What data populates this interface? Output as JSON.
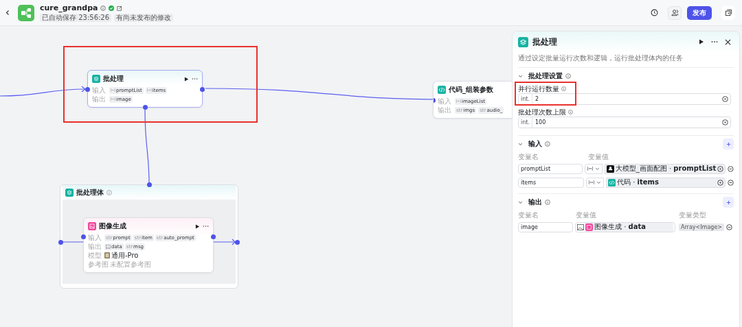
{
  "header": {
    "title": "cure_grandpa",
    "autosave": "已自动保存 23:56:26",
    "unpublished": "有尚未发布的修改",
    "publish": "发布"
  },
  "canvas": {
    "batch_node": {
      "title": "批处理",
      "input_label": "输入",
      "inputs": [
        {
          "kind": "array",
          "label": "promptList"
        },
        {
          "kind": "array",
          "label": "items"
        }
      ],
      "output_label": "输出",
      "outputs": [
        {
          "kind": "array",
          "label": "image"
        }
      ]
    },
    "code_node": {
      "title": "代码_组装参数",
      "input_label": "输入",
      "inputs": [
        {
          "kind": "array",
          "label": "imageList"
        }
      ],
      "output_label": "输出",
      "outputs": [
        {
          "kind": "text",
          "prefix": "str",
          "label": "imgs"
        },
        {
          "kind": "text",
          "prefix": "str",
          "label": "audio_"
        }
      ]
    },
    "batch_body": {
      "title": "批处理体",
      "image_node": {
        "title": "图像生成",
        "input_label": "输入",
        "inputs": [
          {
            "kind": "text",
            "prefix": "str",
            "label": "prompt"
          },
          {
            "kind": "text",
            "prefix": "str",
            "label": "item"
          },
          {
            "kind": "text",
            "prefix": "str",
            "label": "auto_prompt"
          }
        ],
        "output_label": "输出",
        "outputs": [
          {
            "kind": "image",
            "label": "data"
          },
          {
            "kind": "text",
            "prefix": "str",
            "label": "msg"
          }
        ],
        "model_label": "模型",
        "model": "通用-Pro",
        "ref_label": "参考图",
        "ref": "未配置参考图"
      }
    }
  },
  "panel": {
    "title": "批处理",
    "description": "通过设定批量运行次数和逻辑，运行批处理体内的任务",
    "settings": {
      "title": "批处理设置",
      "expanded": true,
      "fields": [
        {
          "label": "并行运行数量",
          "type": "int.",
          "value": "2"
        },
        {
          "label": "批处理次数上限",
          "type": "int.",
          "value": "100"
        }
      ]
    },
    "inputs": {
      "title": "输入",
      "expanded": true,
      "col_name": "变量名",
      "col_value": "变量值",
      "rows": [
        {
          "name": "promptList",
          "kind": "llm",
          "source": "大模型_画面配图 · **promptList**"
        },
        {
          "name": "items",
          "kind": "code",
          "source": "代码 · **items**"
        }
      ]
    },
    "outputs": {
      "title": "输出",
      "expanded": true,
      "col_name": "变量名",
      "col_value": "变量值",
      "col_type": "变量类型",
      "rows": [
        {
          "name": "image",
          "source": "图像生成 · **data**",
          "type": "Array<Image>"
        }
      ]
    }
  }
}
